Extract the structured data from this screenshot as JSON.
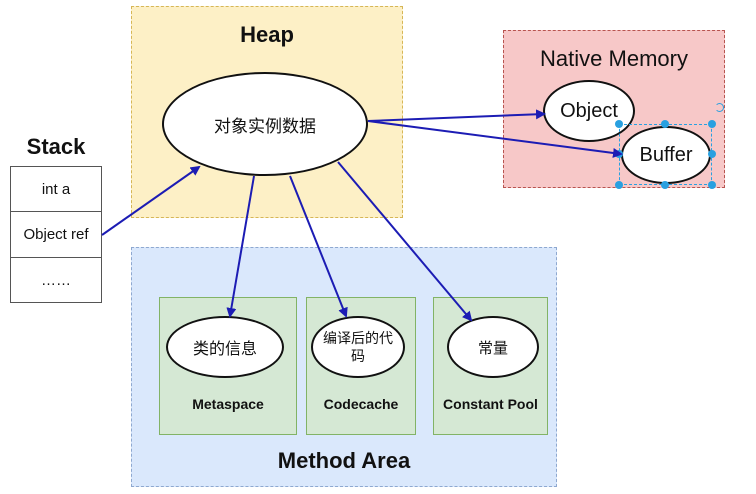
{
  "regions": {
    "heap_title": "Heap",
    "native_title": "Native Memory",
    "method_title": "Method Area"
  },
  "stack": {
    "title": "Stack",
    "cells": [
      "int a",
      "Object ref",
      "……"
    ]
  },
  "nodes": {
    "heap_object": "对象实例数据",
    "native_object": "Object",
    "native_buffer": "Buffer",
    "class_info": "类的信息",
    "compiled_code": "编译后的代码",
    "constants": "常量"
  },
  "subareas": {
    "metaspace": "Metaspace",
    "codecache": "Codecache",
    "constant_pool": "Constant Pool"
  },
  "colors": {
    "arrow": "#1c1cb4",
    "heap_fill": "#fdf0c6",
    "native_fill": "#f7c8c8",
    "method_fill": "#dae8fc",
    "subarea_fill": "#d5e8d4",
    "selection": "#29a0e0"
  }
}
